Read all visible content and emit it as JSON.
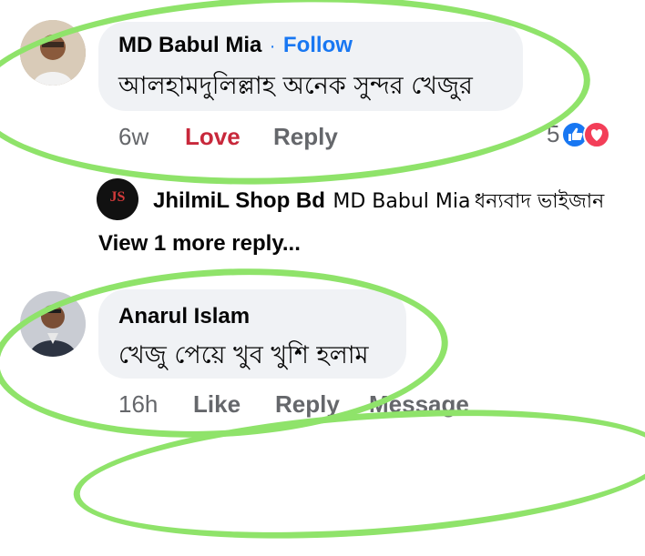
{
  "comments": [
    {
      "author": "MD Babul Mia",
      "follow_label": "Follow",
      "separator": "·",
      "text": "আলহামদুলিল্লাহ অনেক সুন্দর খেজুর",
      "time": "6w",
      "love_label": "Love",
      "reply_label": "Reply",
      "reaction_count": "5"
    },
    {
      "author": "Anarul Islam",
      "text": "খেজু পেয়ে খুব খুশি হলাম",
      "time": "16h",
      "like_label": "Like",
      "reply_label": "Reply",
      "message_label": "Message"
    }
  ],
  "reply": {
    "author": "JhilmiL Shop Bd",
    "mention": "MD Babul Mia",
    "text": "ধন্যবাদ ভাইজান",
    "logo_text": "JS"
  },
  "view_more_label": "View 1 more reply...",
  "colors": {
    "accent": "#1877f2",
    "love": "#c8283b",
    "bubble": "#f0f2f5",
    "highlight": "#8fe36a",
    "muted": "#65676b"
  }
}
